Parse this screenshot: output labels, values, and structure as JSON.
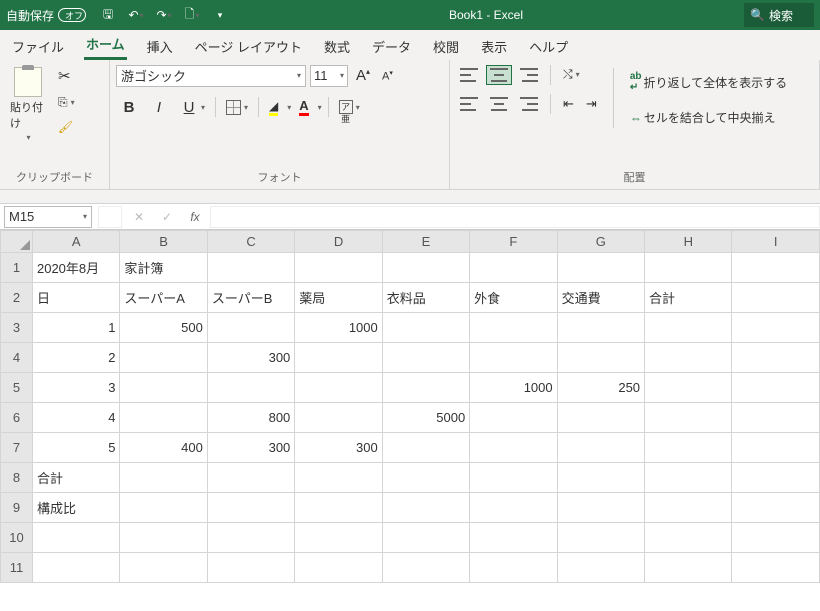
{
  "titlebar": {
    "autosave_label": "自動保存",
    "autosave_state": "オフ",
    "doc_title": "Book1 - Excel",
    "search_label": "検索"
  },
  "tabs": {
    "file": "ファイル",
    "home": "ホーム",
    "insert": "挿入",
    "pagelayout": "ページ レイアウト",
    "formulas": "数式",
    "data": "データ",
    "review": "校閲",
    "view": "表示",
    "help": "ヘルプ"
  },
  "ribbon": {
    "clipboard": {
      "paste": "貼り付け",
      "label": "クリップボード"
    },
    "font": {
      "name": "游ゴシック",
      "size": "11",
      "bold": "B",
      "italic": "I",
      "under": "U",
      "a_red": "A",
      "ruby": "ア亜",
      "label": "フォント"
    },
    "align": {
      "wrap": "折り返して全体を表示する",
      "merge": "セルを結合して中央揃え",
      "label": "配置"
    }
  },
  "formula": {
    "cell_ref": "M15"
  },
  "grid": {
    "cols": [
      "A",
      "B",
      "C",
      "D",
      "E",
      "F",
      "G",
      "H",
      "I"
    ],
    "rows": [
      [
        "2020年8月",
        "家計簿",
        "",
        "",
        "",
        "",
        "",
        "",
        ""
      ],
      [
        "日",
        "スーパーA",
        "スーパーB",
        "薬局",
        "衣料品",
        "外食",
        "交通費",
        "合計",
        ""
      ],
      [
        "1",
        "500",
        "",
        "1000",
        "",
        "",
        "",
        "",
        ""
      ],
      [
        "2",
        "",
        "300",
        "",
        "",
        "",
        "",
        "",
        ""
      ],
      [
        "3",
        "",
        "",
        "",
        "",
        "1000",
        "250",
        "",
        ""
      ],
      [
        "4",
        "",
        "800",
        "",
        "5000",
        "",
        "",
        "",
        ""
      ],
      [
        "5",
        "400",
        "300",
        "300",
        "",
        "",
        "",
        "",
        ""
      ],
      [
        "合計",
        "",
        "",
        "",
        "",
        "",
        "",
        "",
        ""
      ],
      [
        "構成比",
        "",
        "",
        "",
        "",
        "",
        "",
        "",
        ""
      ],
      [
        "",
        "",
        "",
        "",
        "",
        "",
        "",
        "",
        ""
      ],
      [
        "",
        "",
        "",
        "",
        "",
        "",
        "",
        "",
        ""
      ]
    ]
  },
  "chart_data": {
    "type": "table",
    "title": "2020年8月 家計簿",
    "columns": [
      "日",
      "スーパーA",
      "スーパーB",
      "薬局",
      "衣料品",
      "外食",
      "交通費",
      "合計"
    ],
    "rows": [
      {
        "日": 1,
        "スーパーA": 500,
        "スーパーB": null,
        "薬局": 1000,
        "衣料品": null,
        "外食": null,
        "交通費": null,
        "合計": null
      },
      {
        "日": 2,
        "スーパーA": null,
        "スーパーB": 300,
        "薬局": null,
        "衣料品": null,
        "外食": null,
        "交通費": null,
        "合計": null
      },
      {
        "日": 3,
        "スーパーA": null,
        "スーパーB": null,
        "薬局": null,
        "衣料品": null,
        "外食": 1000,
        "交通費": 250,
        "合計": null
      },
      {
        "日": 4,
        "スーパーA": null,
        "スーパーB": 800,
        "薬局": null,
        "衣料品": 5000,
        "外食": null,
        "交通費": null,
        "合計": null
      },
      {
        "日": 5,
        "スーパーA": 400,
        "スーパーB": 300,
        "薬局": 300,
        "衣料品": null,
        "外食": null,
        "交通費": null,
        "合計": null
      }
    ],
    "summary_rows": [
      "合計",
      "構成比"
    ]
  }
}
